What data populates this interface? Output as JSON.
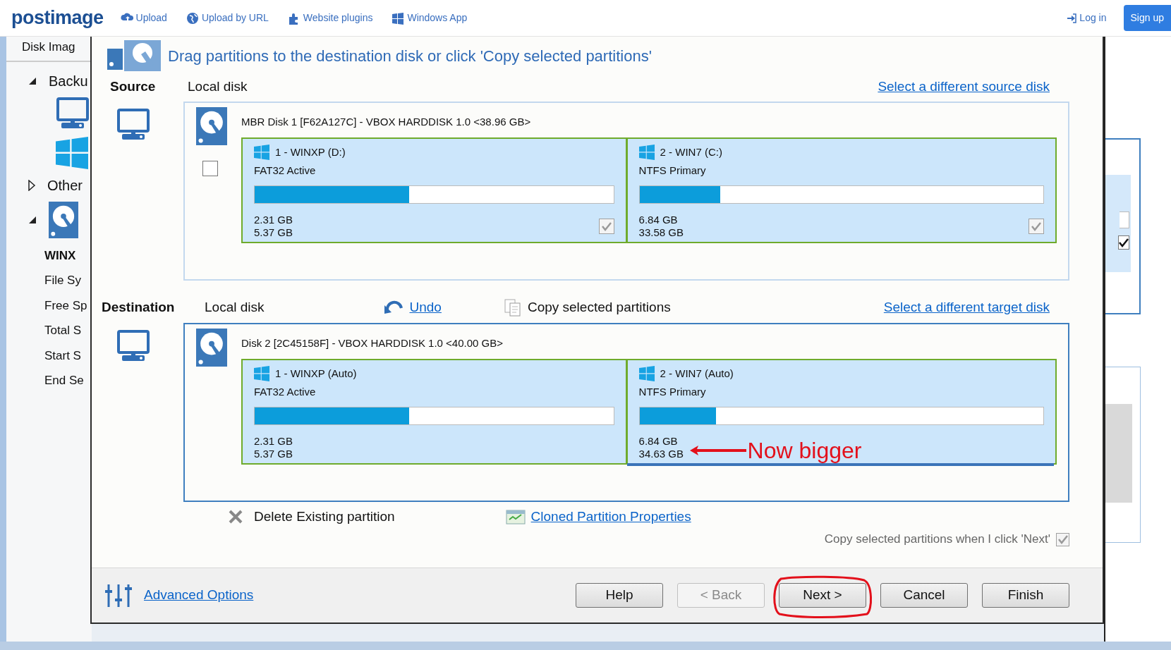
{
  "site_header": {
    "logo": "postimage",
    "nav": [
      {
        "label": "Upload"
      },
      {
        "label": "Upload by URL"
      },
      {
        "label": "Website plugins"
      },
      {
        "label": "Windows App"
      }
    ],
    "login": "Log in",
    "signup": "Sign up"
  },
  "background_app": {
    "title": "Disk Imag",
    "tree": [
      {
        "label": "Backu",
        "expanded": true
      },
      {
        "label": "Other",
        "expanded": false
      },
      {
        "expanded": true
      }
    ],
    "details": [
      {
        "text": "WINX",
        "kind": "heading"
      },
      {
        "text": "File Sy",
        "kind": "row"
      },
      {
        "text": "Free Sp",
        "kind": "row"
      },
      {
        "text": "Total S",
        "kind": "row"
      },
      {
        "text": "Start S",
        "kind": "row"
      },
      {
        "text": "End Se",
        "kind": "row"
      }
    ]
  },
  "background_window": {
    "checkbox": {
      "checked": true
    }
  },
  "dialog": {
    "instruction": "Drag partitions to the destination disk or click 'Copy selected partitions'",
    "source": {
      "label": "Source",
      "disk_type": "Local disk",
      "link": "Select a different source disk",
      "disk": {
        "title": "MBR Disk 1 [F62A127C] - VBOX HARDDISK 1.0  <38.96 GB>",
        "checked": false,
        "partitions": [
          {
            "name": "1 - WINXP (D:)",
            "type": "FAT32 Active",
            "level": 0.43,
            "used": "2.31 GB",
            "total": "5.37 GB",
            "checked": true,
            "disabled": true,
            "selected": false
          },
          {
            "name": "2 - WIN7 (C:)",
            "type": "NTFS Primary",
            "level": 0.2,
            "used": "6.84 GB",
            "total": "33.58 GB",
            "checked": true,
            "disabled": true,
            "selected": false
          }
        ]
      }
    },
    "destination": {
      "label": "Destination",
      "disk_type": "Local disk",
      "undo": "Undo",
      "copy": "Copy selected partitions",
      "link": "Select a different target disk",
      "disk": {
        "title": "Disk 2 [2C45158F] - VBOX HARDDISK 1.0  <40.00 GB>",
        "partitions": [
          {
            "name": "1 - WINXP (Auto)",
            "type": "FAT32 Active",
            "level": 0.43,
            "used": "2.31 GB",
            "total": "5.37 GB",
            "selected": false
          },
          {
            "name": "2 - WIN7 (Auto)",
            "type": "NTFS Primary",
            "level": 0.19,
            "used": "6.84 GB",
            "total": "34.63 GB",
            "selected": true,
            "annotation": "Now bigger"
          }
        ]
      }
    },
    "delete_option": "Delete Existing partition",
    "properties_link": "Cloned Partition Properties",
    "copy_on_next": {
      "label": "Copy selected partitions when I click 'Next'",
      "checked": true,
      "disabled": true
    },
    "advanced_link": "Advanced Options",
    "buttons": [
      {
        "label": "Help",
        "disabled": false,
        "circled": false
      },
      {
        "label": "< Back",
        "disabled": true,
        "circled": false
      },
      {
        "label": "Next >",
        "disabled": false,
        "circled": true
      },
      {
        "label": "Cancel",
        "disabled": false,
        "circled": false
      },
      {
        "label": "Finish",
        "disabled": false,
        "circled": false
      }
    ]
  }
}
